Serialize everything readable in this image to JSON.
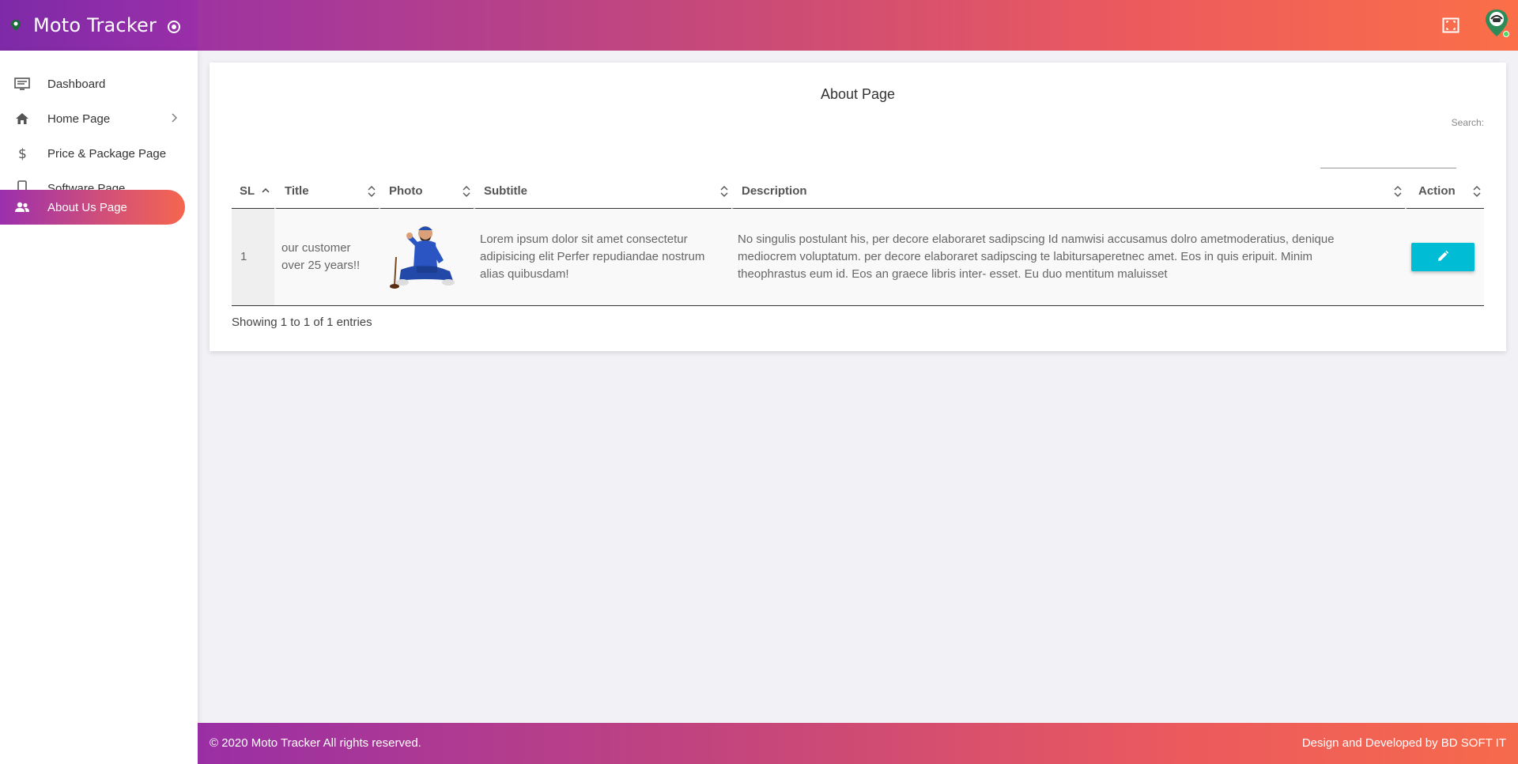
{
  "app": {
    "title": "Moto Tracker"
  },
  "sidebar": {
    "items": [
      {
        "label": "Dashboard",
        "icon": "monitor-icon"
      },
      {
        "label": "Home Page",
        "icon": "home-icon",
        "has_submenu": true
      },
      {
        "label": "Price & Package Page",
        "icon": "dollar-icon"
      },
      {
        "label": "Software Page",
        "icon": "mobile-icon"
      },
      {
        "label": "About Us Page",
        "icon": "users-icon",
        "active": true
      }
    ]
  },
  "main": {
    "title": "About Page",
    "search": {
      "label": "Search:",
      "value": ""
    },
    "table": {
      "columns": [
        "SL",
        "Title",
        "Photo",
        "Subtitle",
        "Description",
        "Action"
      ],
      "rows": [
        {
          "sl": "1",
          "title": "our customer over 25 years!!",
          "photo": "mechanic-photo",
          "subtitle": "Lorem ipsum dolor sit amet consectetur adipisicing elit Perfer repudiandae nostrum alias quibusdam!",
          "description": "No singulis postulant his, per decore elaboraret sadipscing Id namwisi accusamus dolro ametmoderatius, denique mediocrem voluptatum. per decore elaboraret sadipscing te labitursaperetnec amet. Eos in quis eripuit. Minim theophrastus eum id. Eos an graece libris inter- esset. Eu duo mentitum maluisset",
          "action": "edit-icon"
        }
      ]
    },
    "info": "Showing 1 to 1 of 1 entries"
  },
  "footer": {
    "copyright": "© 2020 Moto Tracker All rights reserved.",
    "credit": "Design and Developed by BD SOFT IT"
  },
  "colors": {
    "accent_start": "#8f2bb0",
    "accent_end": "#fb6f48",
    "edit_button": "#00bcd4"
  }
}
